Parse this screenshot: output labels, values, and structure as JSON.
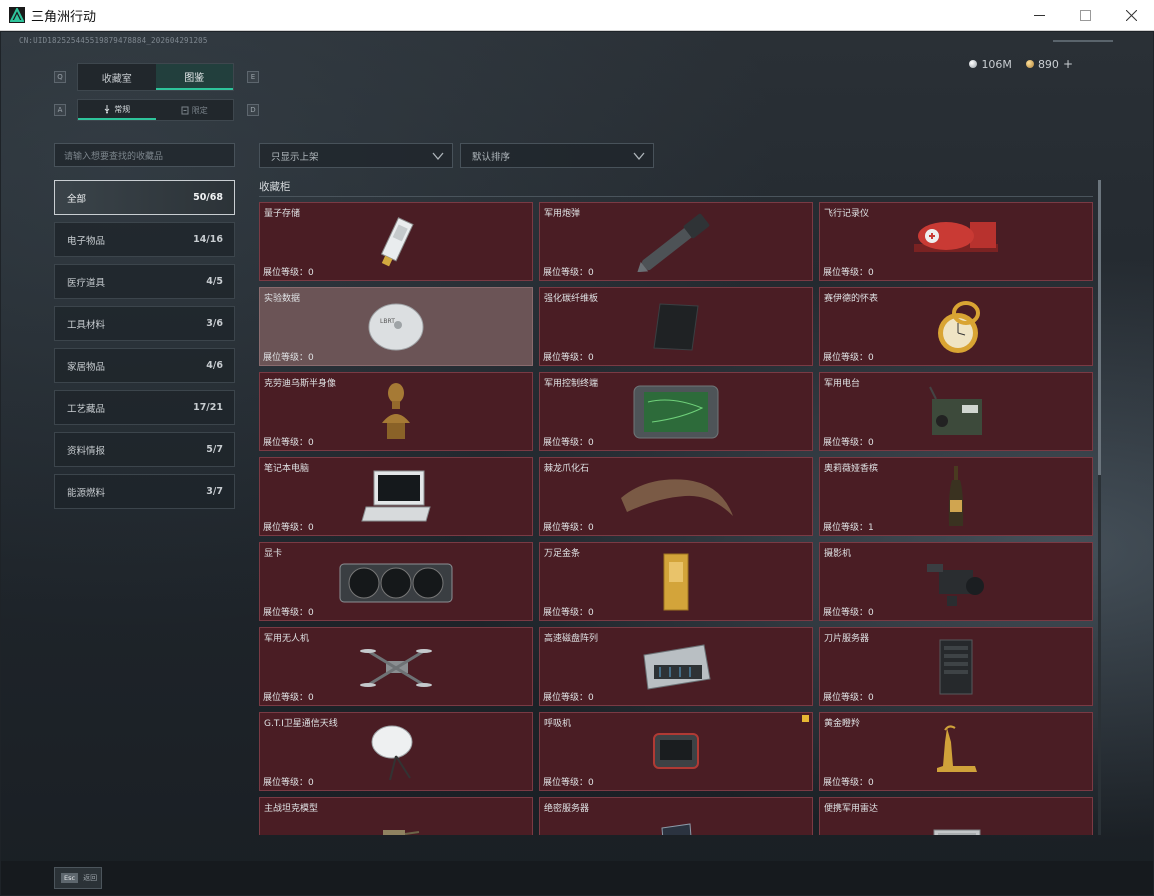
{
  "window": {
    "title": "三角洲行动"
  },
  "uid": "CN:UID18252544551987947888​4_202604291205",
  "currency": [
    {
      "icon": "silver-coin-icon",
      "value": "106M"
    },
    {
      "icon": "gold-coin-icon",
      "value": "890"
    }
  ],
  "tabs": {
    "left_key": "Q",
    "right_key": "E",
    "items": [
      "收藏室",
      "图鉴"
    ],
    "active": 1
  },
  "subtabs": {
    "left_key": "A",
    "right_key": "D",
    "items": [
      "常规",
      "限定"
    ],
    "active": 0
  },
  "search": {
    "placeholder": "请输入想要查找的收藏品"
  },
  "categories": [
    {
      "name": "全部",
      "count": "50/68"
    },
    {
      "name": "电子物品",
      "count": "14/16"
    },
    {
      "name": "医疗道具",
      "count": "4/5"
    },
    {
      "name": "工具材料",
      "count": "3/6"
    },
    {
      "name": "家居物品",
      "count": "4/6"
    },
    {
      "name": "工艺藏品",
      "count": "17/21"
    },
    {
      "name": "资料情报",
      "count": "5/7"
    },
    {
      "name": "能源燃料",
      "count": "3/7"
    }
  ],
  "filters": {
    "shelf": "只显示上架",
    "sort": "默认排序"
  },
  "section_title": "收藏柜",
  "level_label": "展位等级：",
  "items": [
    {
      "name": "量子存储",
      "level": "0",
      "icon": "usb-drive-icon"
    },
    {
      "name": "军用炮弹",
      "level": "0",
      "icon": "artillery-shell-icon"
    },
    {
      "name": "飞行记录仪",
      "level": "0",
      "icon": "flight-recorder-icon"
    },
    {
      "name": "实验数据",
      "level": "0",
      "icon": "disc-icon"
    },
    {
      "name": "强化碳纤维板",
      "level": "0",
      "icon": "carbon-plate-icon"
    },
    {
      "name": "赛伊德的怀表",
      "level": "0",
      "icon": "pocket-watch-icon"
    },
    {
      "name": "克劳迪乌斯半身像",
      "level": "0",
      "icon": "bust-icon"
    },
    {
      "name": "军用控制终端",
      "level": "0",
      "icon": "control-terminal-icon"
    },
    {
      "name": "军用电台",
      "level": "0",
      "icon": "radio-icon"
    },
    {
      "name": "笔记本电脑",
      "level": "0",
      "icon": "laptop-icon"
    },
    {
      "name": "棘龙爪化石",
      "level": "0",
      "icon": "claw-fossil-icon"
    },
    {
      "name": "奥莉薇娅香槟",
      "level": "1",
      "icon": "champagne-icon"
    },
    {
      "name": "显卡",
      "level": "0",
      "icon": "graphics-card-icon"
    },
    {
      "name": "万足金条",
      "level": "0",
      "icon": "gold-bar-icon"
    },
    {
      "name": "摄影机",
      "level": "0",
      "icon": "camera-icon"
    },
    {
      "name": "军用无人机",
      "level": "0",
      "icon": "drone-icon"
    },
    {
      "name": "高速磁盘阵列",
      "level": "0",
      "icon": "disk-array-icon"
    },
    {
      "name": "刀片服务器",
      "level": "0",
      "icon": "blade-server-icon"
    },
    {
      "name": "G.T.I卫星通信天线",
      "level": "0",
      "icon": "satellite-dish-icon"
    },
    {
      "name": "呼吸机",
      "level": "0",
      "icon": "ventilator-icon"
    },
    {
      "name": "黄金瞪羚",
      "level": "0",
      "icon": "gold-gazelle-icon"
    },
    {
      "name": "主战坦克模型",
      "level": "",
      "icon": "tank-model-icon"
    },
    {
      "name": "绝密服务器",
      "level": "",
      "icon": "secret-server-icon"
    },
    {
      "name": "便携军用雷达",
      "level": "",
      "icon": "radar-icon"
    }
  ],
  "footer": {
    "key": "Esc",
    "label": "返回"
  },
  "colors": {
    "accent": "#2ec49b",
    "card_bg": "#4a1d24",
    "card_selected": "#6b5456",
    "badge": "#e7b733"
  }
}
